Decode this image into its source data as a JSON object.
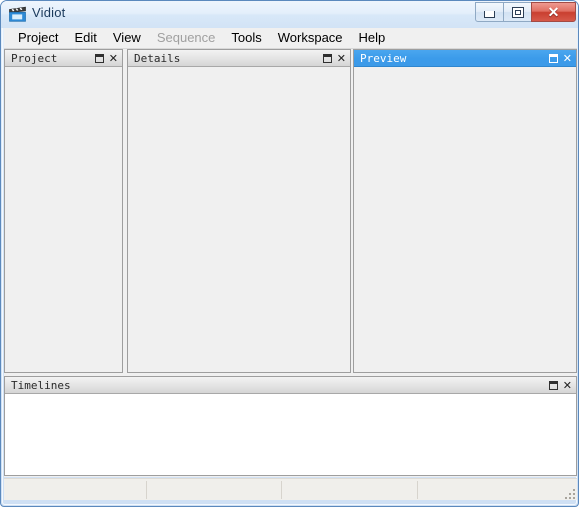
{
  "window": {
    "title": "Vidiot",
    "icon": "film-clapperboard-icon",
    "controls": {
      "minimize": "minimize-button",
      "maximize": "maximize-button",
      "close": "close-button",
      "close_glyph": "✕"
    },
    "accent_color": "#3c9ae8",
    "close_color": "#c93f30",
    "frame_color": "#5b89bd"
  },
  "menubar": {
    "items": [
      {
        "label": "Project",
        "disabled": false
      },
      {
        "label": "Edit",
        "disabled": false
      },
      {
        "label": "View",
        "disabled": false
      },
      {
        "label": "Sequence",
        "disabled": true
      },
      {
        "label": "Tools",
        "disabled": false
      },
      {
        "label": "Workspace",
        "disabled": false
      },
      {
        "label": "Help",
        "disabled": false
      }
    ]
  },
  "panes": {
    "project": {
      "title": "Project",
      "active": false,
      "body": "empty",
      "float_button": "float-button",
      "close_button": "close-button"
    },
    "details": {
      "title": "Details",
      "active": false,
      "body": "empty",
      "float_button": "float-button",
      "close_button": "close-button"
    },
    "preview": {
      "title": "Preview",
      "active": true,
      "body": "empty",
      "float_button": "float-button",
      "close_button": "close-button"
    },
    "timelines": {
      "title": "Timelines",
      "active": false,
      "body": "empty",
      "float_button": "float-button",
      "close_button": "close-button"
    }
  },
  "statusbar": {
    "fields": [
      {
        "text": ""
      },
      {
        "text": ""
      },
      {
        "text": ""
      },
      {
        "text": ""
      }
    ],
    "grip": "resize-grip"
  }
}
